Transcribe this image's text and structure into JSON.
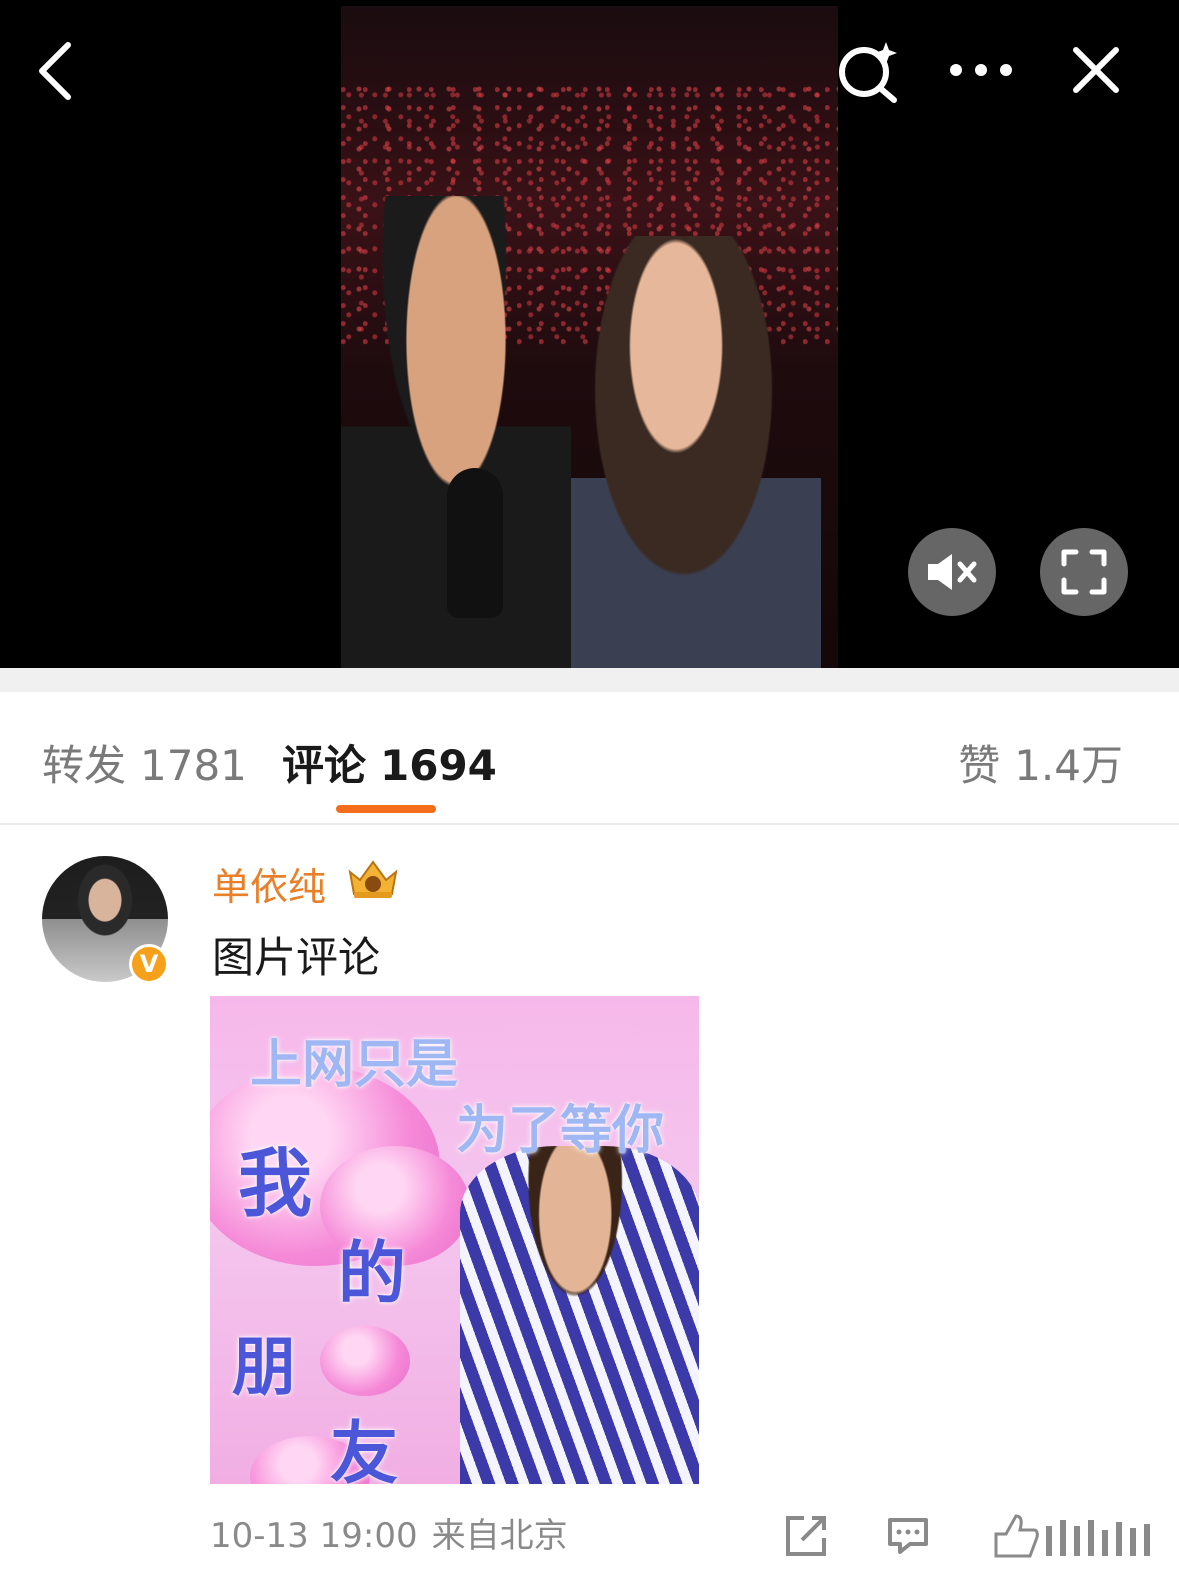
{
  "video": {
    "buttons": {
      "back": "back-icon",
      "search": "sparkle-search-icon",
      "more": "more-icon",
      "close": "close-icon",
      "mute": "mute-icon",
      "fullscreen": "fullscreen-icon"
    }
  },
  "tabs": {
    "repost": {
      "label": "转发",
      "count": "1781"
    },
    "comments": {
      "label": "评论",
      "count": "1694"
    },
    "likes": {
      "label": "赞",
      "count": "1.4万"
    },
    "accent_color": "#f36d1b"
  },
  "comment": {
    "username": "单依纯",
    "verified_mark": "V",
    "text": "图片评论",
    "image_text": {
      "line1": "上网只是",
      "line2": "为了等你",
      "char1": "我",
      "char2": "的",
      "char3": "朋",
      "char4": "友"
    },
    "date": "10-13 19:00",
    "location": "来自北京",
    "username_color": "#e8802a"
  }
}
